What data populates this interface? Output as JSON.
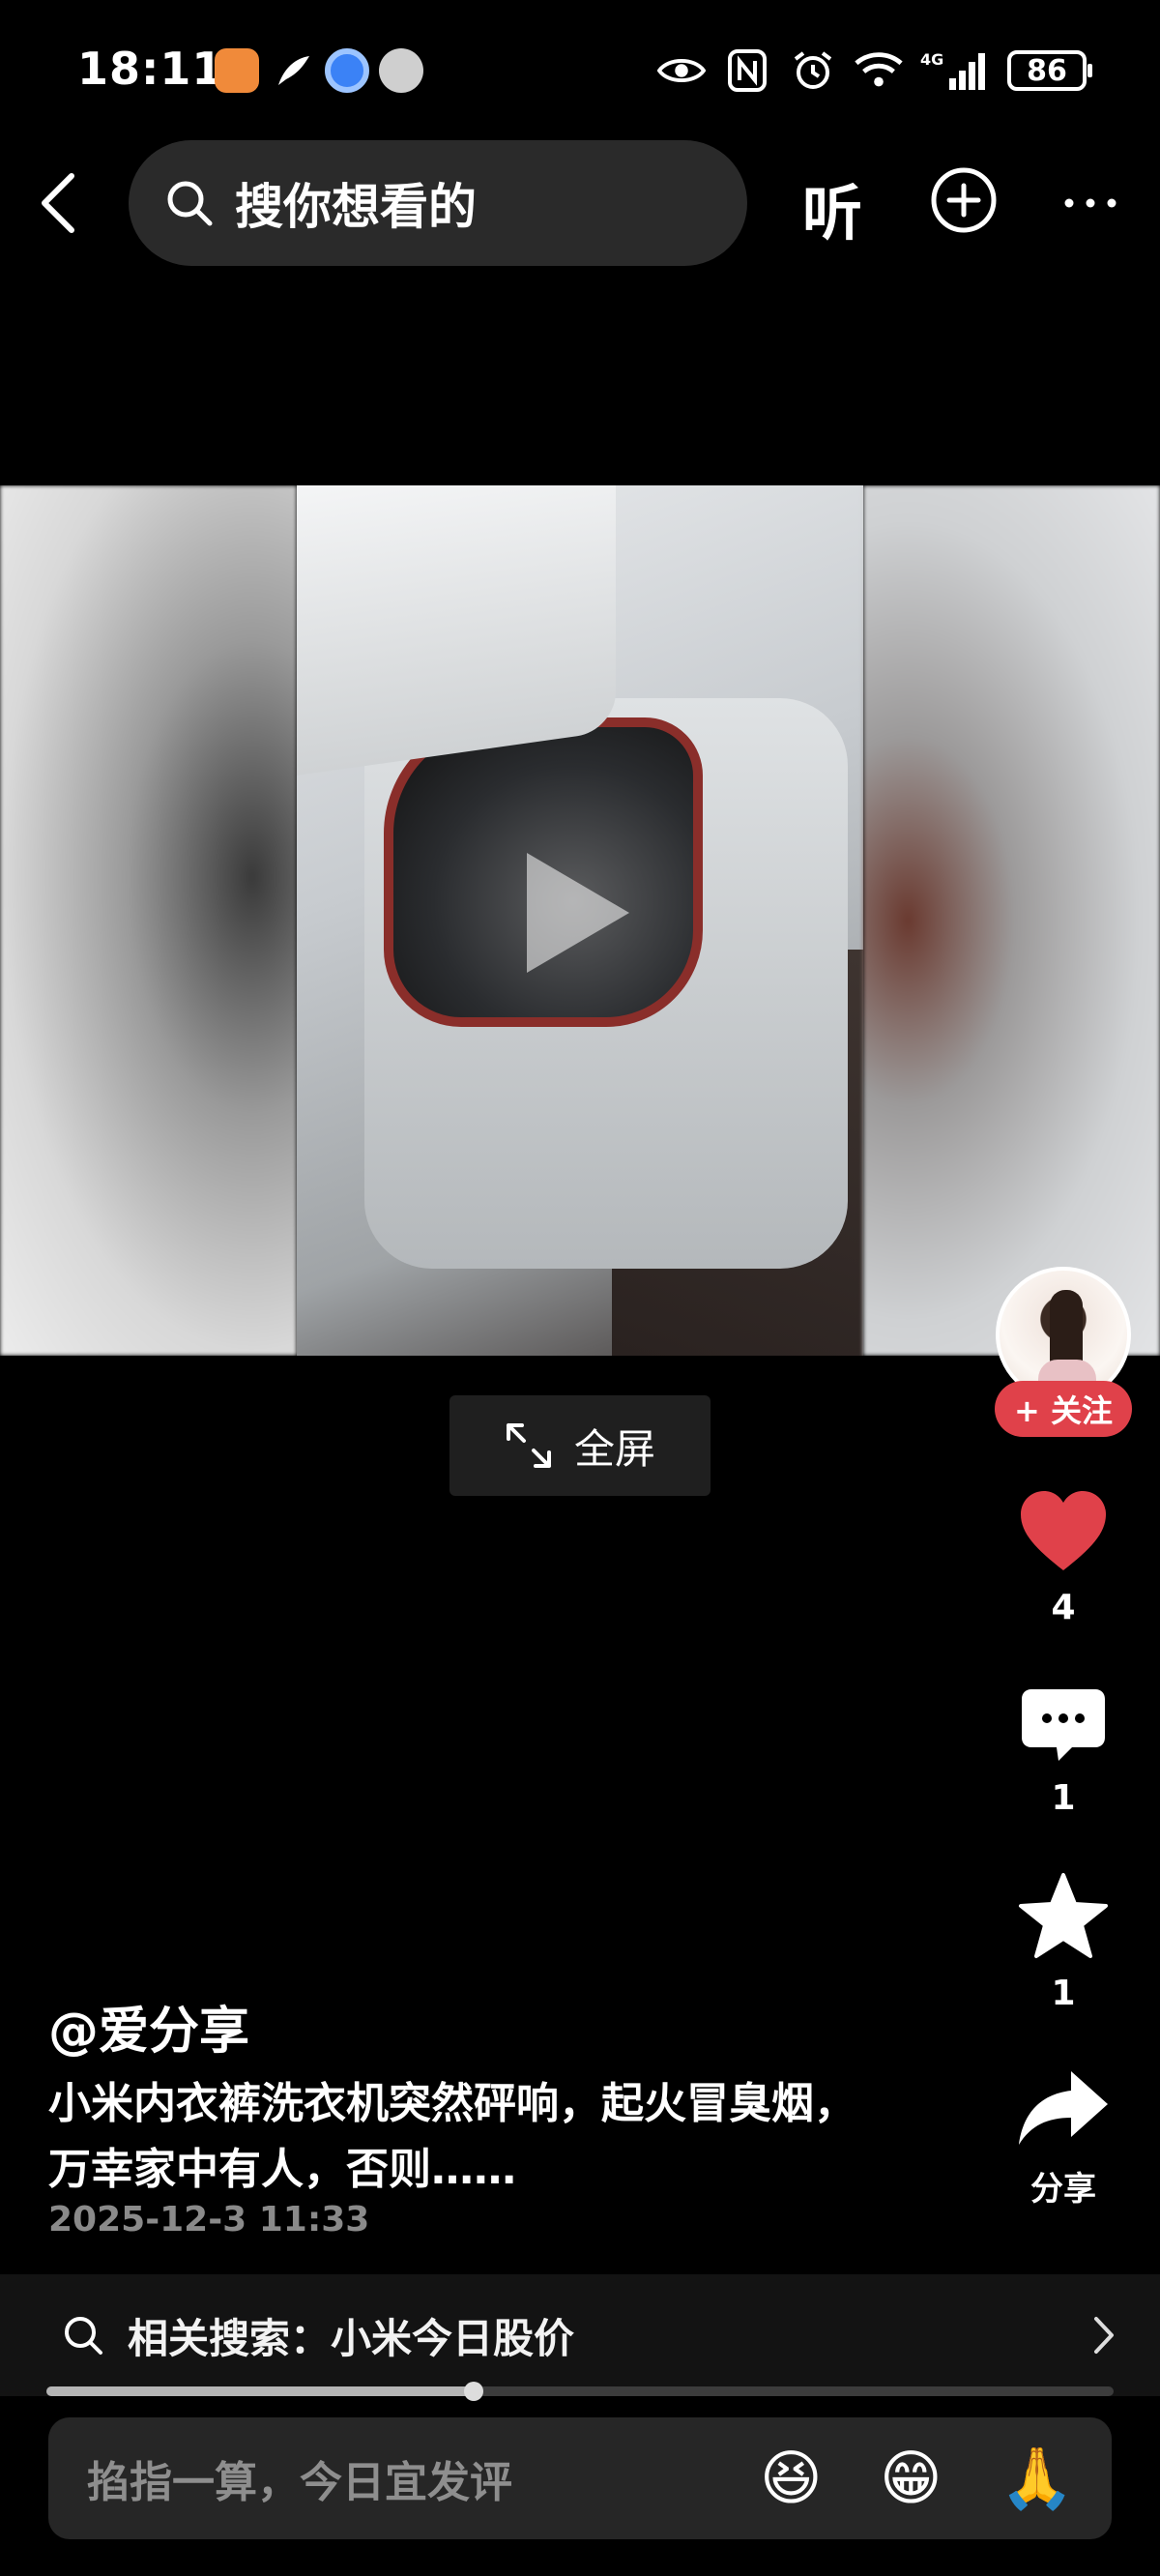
{
  "status_bar": {
    "time": "18:11",
    "battery": "86",
    "network": "4G"
  },
  "header": {
    "search_placeholder": "搜你想看的",
    "listen_label": "听"
  },
  "video": {
    "fullscreen_label": "全屏"
  },
  "actions": {
    "follow_label": "+ 关注",
    "like_count": "4",
    "comment_count": "1",
    "favorite_count": "1",
    "share_label": "分享",
    "like_color": "#e0414a"
  },
  "post": {
    "author": "@爱分享",
    "description_line1": "小米内衣裤洗衣机突然砰响，起火冒臭烟，",
    "description_line2": "万幸家中有人，否则……",
    "date": "2025-12-3 11:33"
  },
  "related_search": {
    "label": "相关搜索：小米今日股价"
  },
  "playback": {
    "progress": 0.4
  },
  "comment": {
    "placeholder": "掐指一算，今日宜发评",
    "emojis": [
      "😆",
      "😁",
      "🙏"
    ]
  }
}
